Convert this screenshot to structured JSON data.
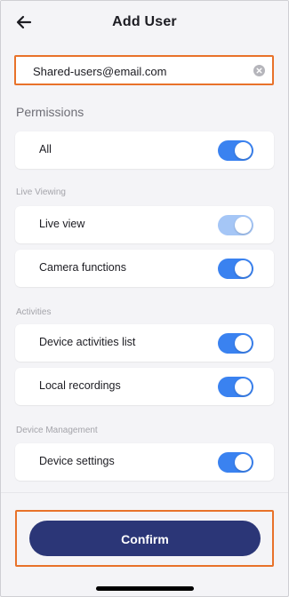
{
  "header": {
    "title": "Add User",
    "back_icon": "arrow-left-icon"
  },
  "email": {
    "value": "Shared-users@email.com",
    "clear_icon": "clear-circle-icon"
  },
  "permissions": {
    "heading": "Permissions",
    "all": {
      "label": "All",
      "on": true
    }
  },
  "live_viewing": {
    "label": "Live Viewing",
    "items": [
      {
        "label": "Live view",
        "on": true,
        "disabled": true
      },
      {
        "label": "Camera functions",
        "on": true,
        "disabled": false
      }
    ]
  },
  "activities": {
    "label": "Activities",
    "items": [
      {
        "label": "Device activities list",
        "on": true,
        "disabled": false
      },
      {
        "label": "Local recordings",
        "on": true,
        "disabled": false
      }
    ]
  },
  "device_management": {
    "label": "Device Management",
    "items": [
      {
        "label": "Device settings",
        "on": true,
        "disabled": false
      }
    ]
  },
  "footer": {
    "confirm_label": "Confirm"
  },
  "colors": {
    "toggle_on": "#3a82f0",
    "toggle_disabled": "#a5c6f6",
    "confirm_button": "#2b3677",
    "highlight_border": "#e8722a"
  }
}
